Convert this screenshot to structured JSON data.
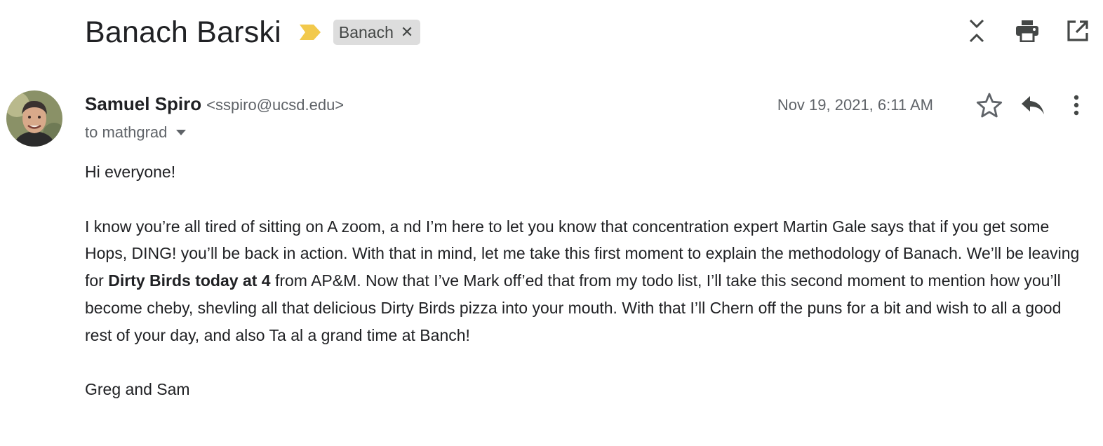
{
  "thread": {
    "subject": "Banach Barski",
    "label": "Banach"
  },
  "message": {
    "sender_name": "Samuel Spiro",
    "sender_email": "<sspiro@ucsd.edu>",
    "recipients": "to mathgrad",
    "date": "Nov 19, 2021, 6:11 AM",
    "body": {
      "greeting": "Hi everyone!",
      "para_part1": "I know you’re all tired of sitting on A zoom, a nd I’m here to let you know that concentration expert Martin Gale says that if you get some Hops, DING! you’ll be back in action.  With that in mind, let me take this first moment to explain the methodology of Banach.  We’ll be leaving for ",
      "para_bold": "Dirty Birds today at 4",
      "para_part2": " from AP&M.  Now that I’ve Mark off’ed that from my todo list, I’ll take this second moment to mention how you’ll become cheby, shevling all that delicious Dirty Birds pizza into your mouth.  With that I’ll Chern off the puns for a bit and wish to all a good rest of your day, and also Ta al a grand time at Banch!",
      "signature": "Greg and Sam"
    }
  },
  "colors": {
    "importance_marker": "#f2c94c",
    "label_chip_bg": "#dddddd",
    "icon_gray": "#5f6368",
    "text_primary": "#202124"
  },
  "icons": [
    "importance-marker-icon",
    "close-icon",
    "collapse-all-icon",
    "print-icon",
    "open-in-new-window-icon",
    "avatar",
    "dropdown-caret-icon",
    "star-icon",
    "reply-icon",
    "more-vert-icon"
  ]
}
